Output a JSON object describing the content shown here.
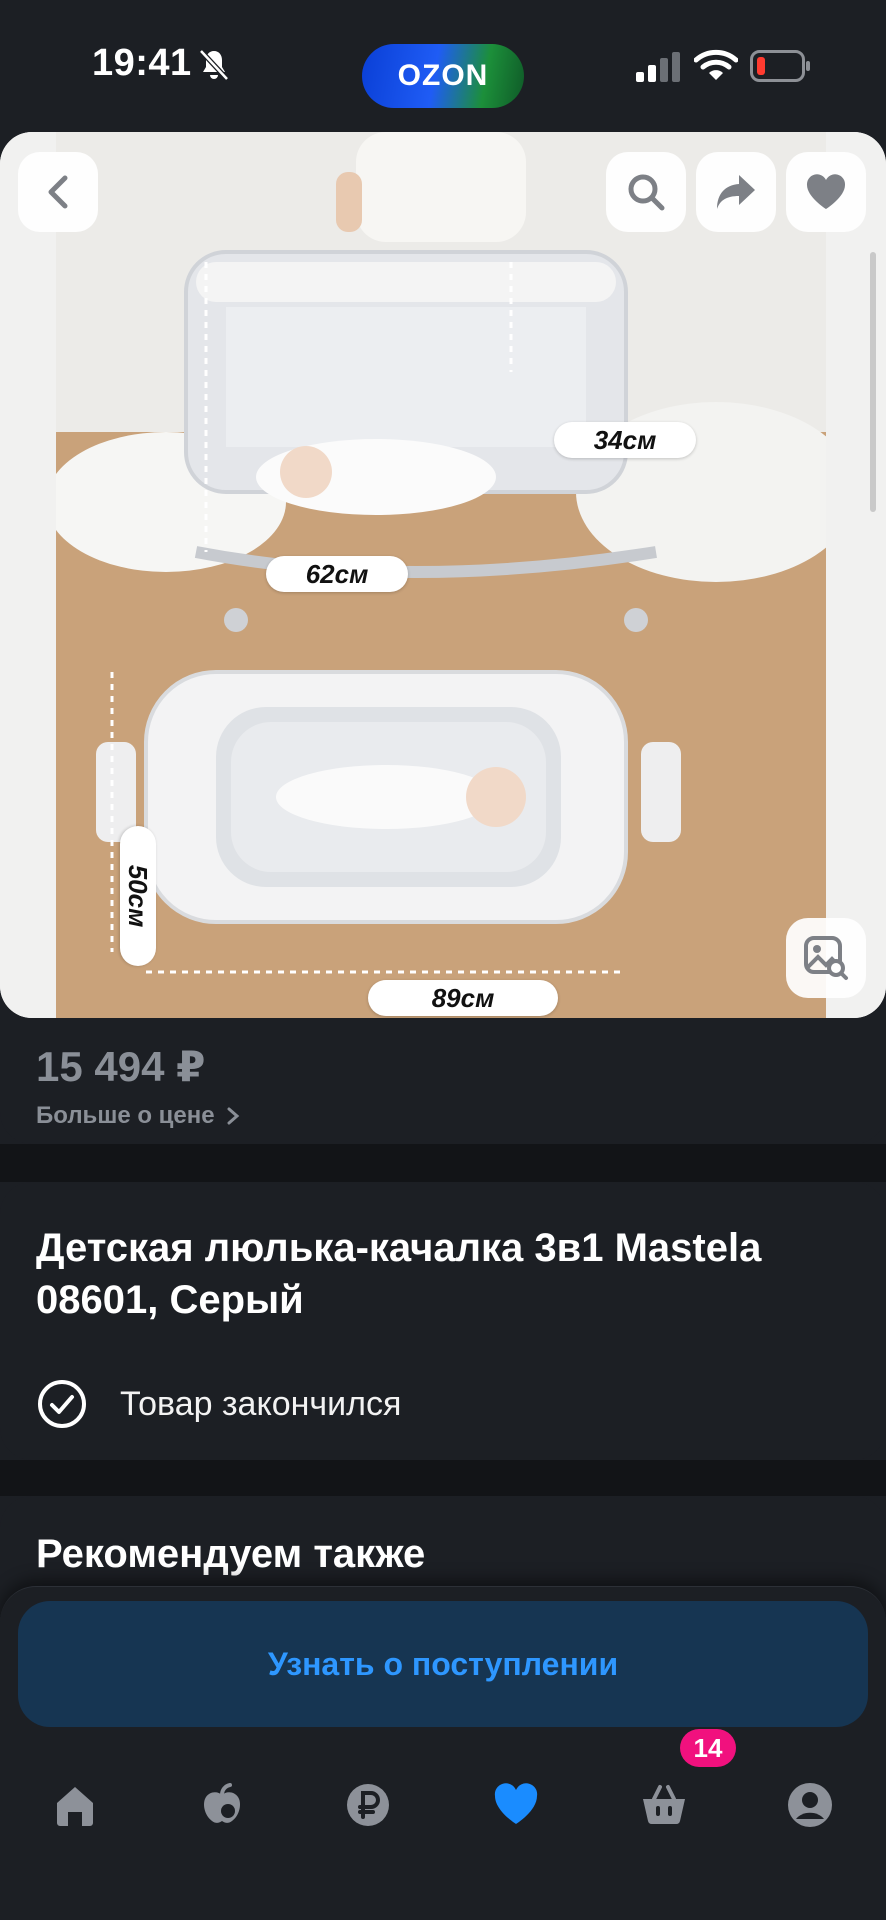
{
  "status_bar": {
    "time": "19:41",
    "brand_logo": "OZON",
    "icons": [
      "bell-muted-icon",
      "signal-icon",
      "wifi-icon",
      "battery-low-icon"
    ]
  },
  "gallery": {
    "dimension_labels": {
      "height": "34см",
      "width_side": "62см",
      "width_top": "50см",
      "length": "89см"
    },
    "buttons": [
      "back-icon",
      "search-icon",
      "share-icon",
      "heart-icon",
      "image-search-icon"
    ]
  },
  "price": {
    "value": "15 494 ₽",
    "more_link": "Больше о цене"
  },
  "product": {
    "title": "Детская люлька-качалка 3в1 Mastela 08601, Серый",
    "stock_status": "Товар закончился"
  },
  "recommendations": {
    "title": "Рекомендуем также"
  },
  "bottom_sheet": {
    "notify_label": "Узнать о поступлении"
  },
  "tab_bar": {
    "tabs": [
      "home-icon",
      "fresh-icon",
      "finance-icon",
      "favorites-icon",
      "cart-icon",
      "profile-icon"
    ],
    "active_tab": "favorites-icon",
    "cart_badge": "14"
  },
  "colors": {
    "background": "#1c1f24",
    "accent_blue": "#2e97ff",
    "notify_bg": "#163552",
    "badge_pink": "#f1117e",
    "muted_text": "#8a8f97"
  }
}
